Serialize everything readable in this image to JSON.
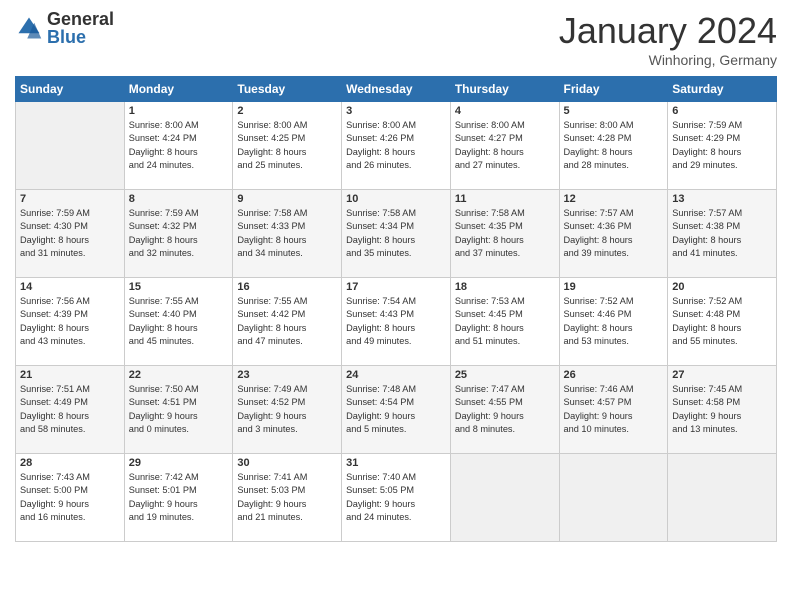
{
  "header": {
    "logo_general": "General",
    "logo_blue": "Blue",
    "month": "January 2024",
    "location": "Winhoring, Germany"
  },
  "weekdays": [
    "Sunday",
    "Monday",
    "Tuesday",
    "Wednesday",
    "Thursday",
    "Friday",
    "Saturday"
  ],
  "weeks": [
    [
      {
        "day": "",
        "content": ""
      },
      {
        "day": "1",
        "content": "Sunrise: 8:00 AM\nSunset: 4:24 PM\nDaylight: 8 hours\nand 24 minutes."
      },
      {
        "day": "2",
        "content": "Sunrise: 8:00 AM\nSunset: 4:25 PM\nDaylight: 8 hours\nand 25 minutes."
      },
      {
        "day": "3",
        "content": "Sunrise: 8:00 AM\nSunset: 4:26 PM\nDaylight: 8 hours\nand 26 minutes."
      },
      {
        "day": "4",
        "content": "Sunrise: 8:00 AM\nSunset: 4:27 PM\nDaylight: 8 hours\nand 27 minutes."
      },
      {
        "day": "5",
        "content": "Sunrise: 8:00 AM\nSunset: 4:28 PM\nDaylight: 8 hours\nand 28 minutes."
      },
      {
        "day": "6",
        "content": "Sunrise: 7:59 AM\nSunset: 4:29 PM\nDaylight: 8 hours\nand 29 minutes."
      }
    ],
    [
      {
        "day": "7",
        "content": "Sunrise: 7:59 AM\nSunset: 4:30 PM\nDaylight: 8 hours\nand 31 minutes."
      },
      {
        "day": "8",
        "content": "Sunrise: 7:59 AM\nSunset: 4:32 PM\nDaylight: 8 hours\nand 32 minutes."
      },
      {
        "day": "9",
        "content": "Sunrise: 7:58 AM\nSunset: 4:33 PM\nDaylight: 8 hours\nand 34 minutes."
      },
      {
        "day": "10",
        "content": "Sunrise: 7:58 AM\nSunset: 4:34 PM\nDaylight: 8 hours\nand 35 minutes."
      },
      {
        "day": "11",
        "content": "Sunrise: 7:58 AM\nSunset: 4:35 PM\nDaylight: 8 hours\nand 37 minutes."
      },
      {
        "day": "12",
        "content": "Sunrise: 7:57 AM\nSunset: 4:36 PM\nDaylight: 8 hours\nand 39 minutes."
      },
      {
        "day": "13",
        "content": "Sunrise: 7:57 AM\nSunset: 4:38 PM\nDaylight: 8 hours\nand 41 minutes."
      }
    ],
    [
      {
        "day": "14",
        "content": "Sunrise: 7:56 AM\nSunset: 4:39 PM\nDaylight: 8 hours\nand 43 minutes."
      },
      {
        "day": "15",
        "content": "Sunrise: 7:55 AM\nSunset: 4:40 PM\nDaylight: 8 hours\nand 45 minutes."
      },
      {
        "day": "16",
        "content": "Sunrise: 7:55 AM\nSunset: 4:42 PM\nDaylight: 8 hours\nand 47 minutes."
      },
      {
        "day": "17",
        "content": "Sunrise: 7:54 AM\nSunset: 4:43 PM\nDaylight: 8 hours\nand 49 minutes."
      },
      {
        "day": "18",
        "content": "Sunrise: 7:53 AM\nSunset: 4:45 PM\nDaylight: 8 hours\nand 51 minutes."
      },
      {
        "day": "19",
        "content": "Sunrise: 7:52 AM\nSunset: 4:46 PM\nDaylight: 8 hours\nand 53 minutes."
      },
      {
        "day": "20",
        "content": "Sunrise: 7:52 AM\nSunset: 4:48 PM\nDaylight: 8 hours\nand 55 minutes."
      }
    ],
    [
      {
        "day": "21",
        "content": "Sunrise: 7:51 AM\nSunset: 4:49 PM\nDaylight: 8 hours\nand 58 minutes."
      },
      {
        "day": "22",
        "content": "Sunrise: 7:50 AM\nSunset: 4:51 PM\nDaylight: 9 hours\nand 0 minutes."
      },
      {
        "day": "23",
        "content": "Sunrise: 7:49 AM\nSunset: 4:52 PM\nDaylight: 9 hours\nand 3 minutes."
      },
      {
        "day": "24",
        "content": "Sunrise: 7:48 AM\nSunset: 4:54 PM\nDaylight: 9 hours\nand 5 minutes."
      },
      {
        "day": "25",
        "content": "Sunrise: 7:47 AM\nSunset: 4:55 PM\nDaylight: 9 hours\nand 8 minutes."
      },
      {
        "day": "26",
        "content": "Sunrise: 7:46 AM\nSunset: 4:57 PM\nDaylight: 9 hours\nand 10 minutes."
      },
      {
        "day": "27",
        "content": "Sunrise: 7:45 AM\nSunset: 4:58 PM\nDaylight: 9 hours\nand 13 minutes."
      }
    ],
    [
      {
        "day": "28",
        "content": "Sunrise: 7:43 AM\nSunset: 5:00 PM\nDaylight: 9 hours\nand 16 minutes."
      },
      {
        "day": "29",
        "content": "Sunrise: 7:42 AM\nSunset: 5:01 PM\nDaylight: 9 hours\nand 19 minutes."
      },
      {
        "day": "30",
        "content": "Sunrise: 7:41 AM\nSunset: 5:03 PM\nDaylight: 9 hours\nand 21 minutes."
      },
      {
        "day": "31",
        "content": "Sunrise: 7:40 AM\nSunset: 5:05 PM\nDaylight: 9 hours\nand 24 minutes."
      },
      {
        "day": "",
        "content": ""
      },
      {
        "day": "",
        "content": ""
      },
      {
        "day": "",
        "content": ""
      }
    ]
  ]
}
